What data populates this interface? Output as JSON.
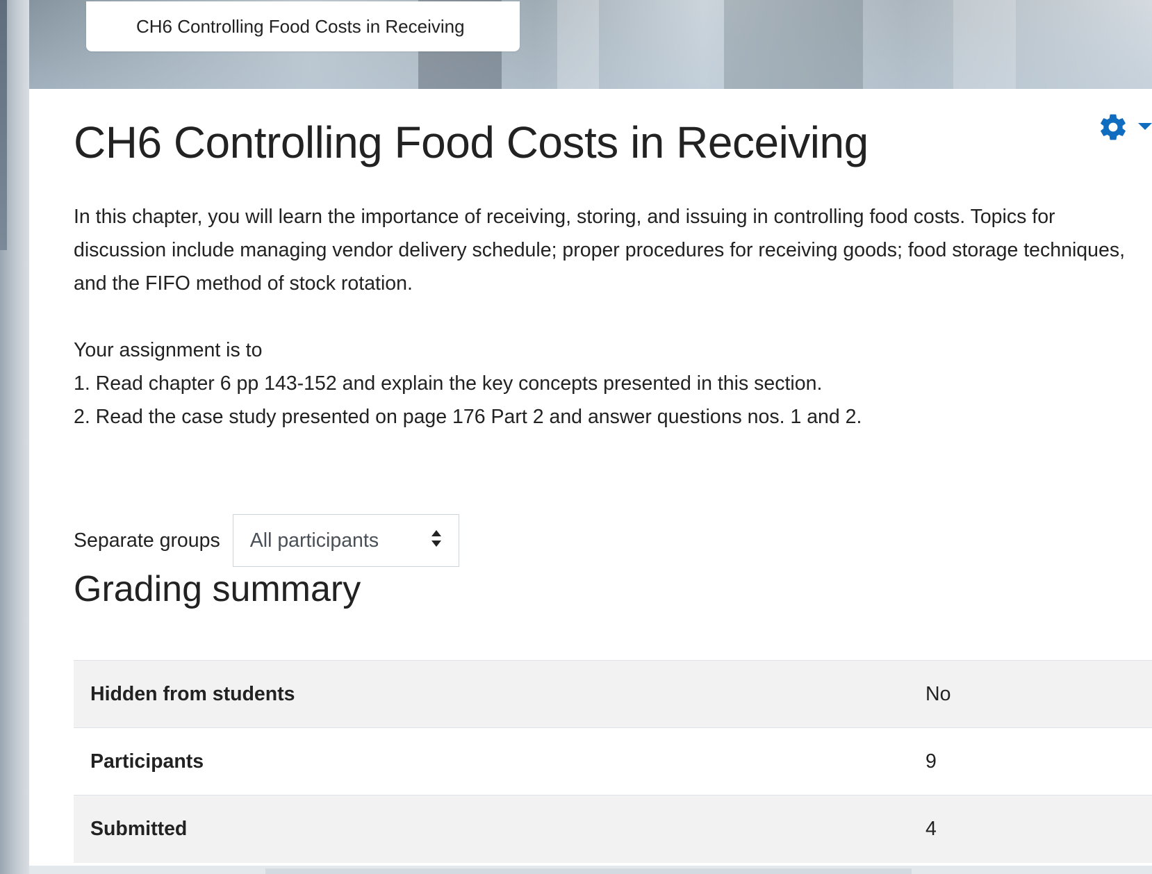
{
  "breadcrumb": {
    "label": "CH6 Controlling Food Costs in Receiving"
  },
  "page": {
    "title": "CH6 Controlling Food Costs in Receiving"
  },
  "description": {
    "paragraph1": "In this chapter, you will learn the importance of receiving, storing, and issuing in controlling food costs. Topics for discussion include managing vendor delivery schedule; proper procedures for receiving goods; food storage techniques, and the FIFO method of stock rotation.",
    "assignment_intro": "Your assignment is to",
    "item1": "1. Read chapter 6 pp 143-152 and explain the key concepts presented in this section.",
    "item2": "2. Read the case study presented on page 176 Part 2 and answer questions nos. 1 and 2."
  },
  "groups": {
    "label": "Separate groups",
    "selected": "All participants"
  },
  "grading": {
    "title": "Grading summary",
    "rows": [
      {
        "label": "Hidden from students",
        "value": "No"
      },
      {
        "label": "Participants",
        "value": "9"
      },
      {
        "label": "Submitted",
        "value": "4"
      }
    ]
  },
  "icons": {
    "settings": "gear-icon",
    "dropdown": "caret-down-icon",
    "select": "sort-arrows-icon"
  },
  "colors": {
    "accent": "#0f6cbf"
  }
}
